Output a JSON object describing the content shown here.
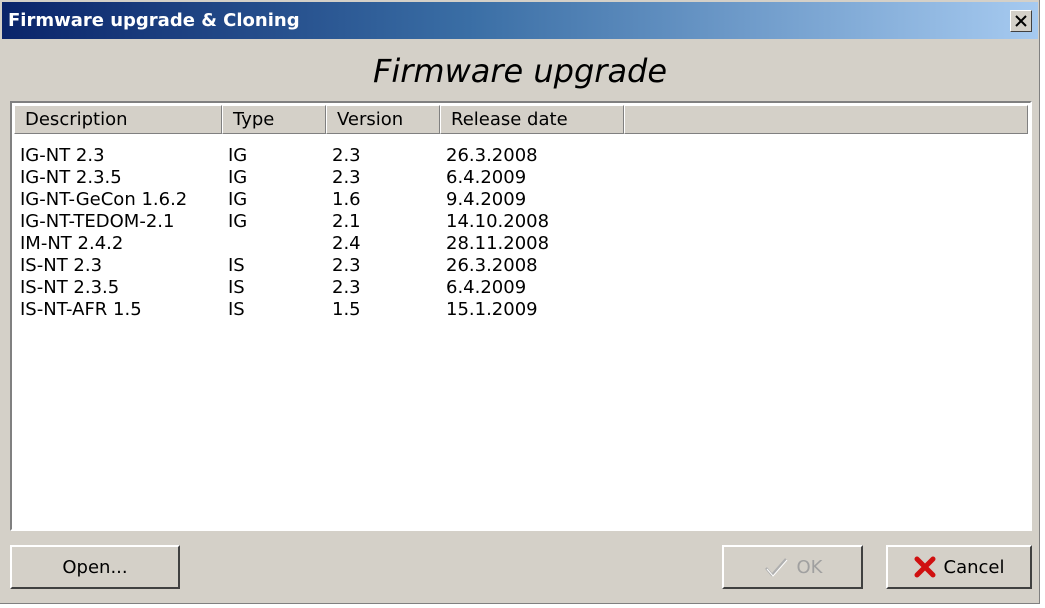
{
  "window": {
    "title": "Firmware upgrade & Cloning",
    "close_glyph": "×"
  },
  "heading": "Firmware upgrade",
  "columns": [
    "Description",
    "Type",
    "Version",
    "Release date"
  ],
  "rows": [
    {
      "description": "IG-NT 2.3",
      "type": "IG",
      "version": "2.3",
      "release_date": "26.3.2008"
    },
    {
      "description": "IG-NT 2.3.5",
      "type": "IG",
      "version": "2.3",
      "release_date": "6.4.2009"
    },
    {
      "description": "IG-NT-GeCon 1.6.2",
      "type": "IG",
      "version": "1.6",
      "release_date": "9.4.2009"
    },
    {
      "description": "IG-NT-TEDOM-2.1",
      "type": "IG",
      "version": "2.1",
      "release_date": "14.10.2008"
    },
    {
      "description": "IM-NT 2.4.2",
      "type": "",
      "version": "2.4",
      "release_date": "28.11.2008"
    },
    {
      "description": "IS-NT 2.3",
      "type": "IS",
      "version": "2.3",
      "release_date": "26.3.2008"
    },
    {
      "description": "IS-NT 2.3.5",
      "type": "IS",
      "version": "2.3",
      "release_date": "6.4.2009"
    },
    {
      "description": "IS-NT-AFR 1.5",
      "type": "IS",
      "version": "1.5",
      "release_date": "15.1.2009"
    }
  ],
  "buttons": {
    "open_label": "Open...",
    "ok_label": "OK",
    "cancel_label": "Cancel"
  },
  "icons": {
    "close": "close-icon",
    "ok": "checkmark-icon",
    "cancel": "red-x-icon"
  },
  "colors": {
    "titlebar_start": "#0a246a",
    "titlebar_end": "#a6caf0",
    "cancel_icon": "#d01010",
    "disabled_text": "#a0a0a0"
  }
}
